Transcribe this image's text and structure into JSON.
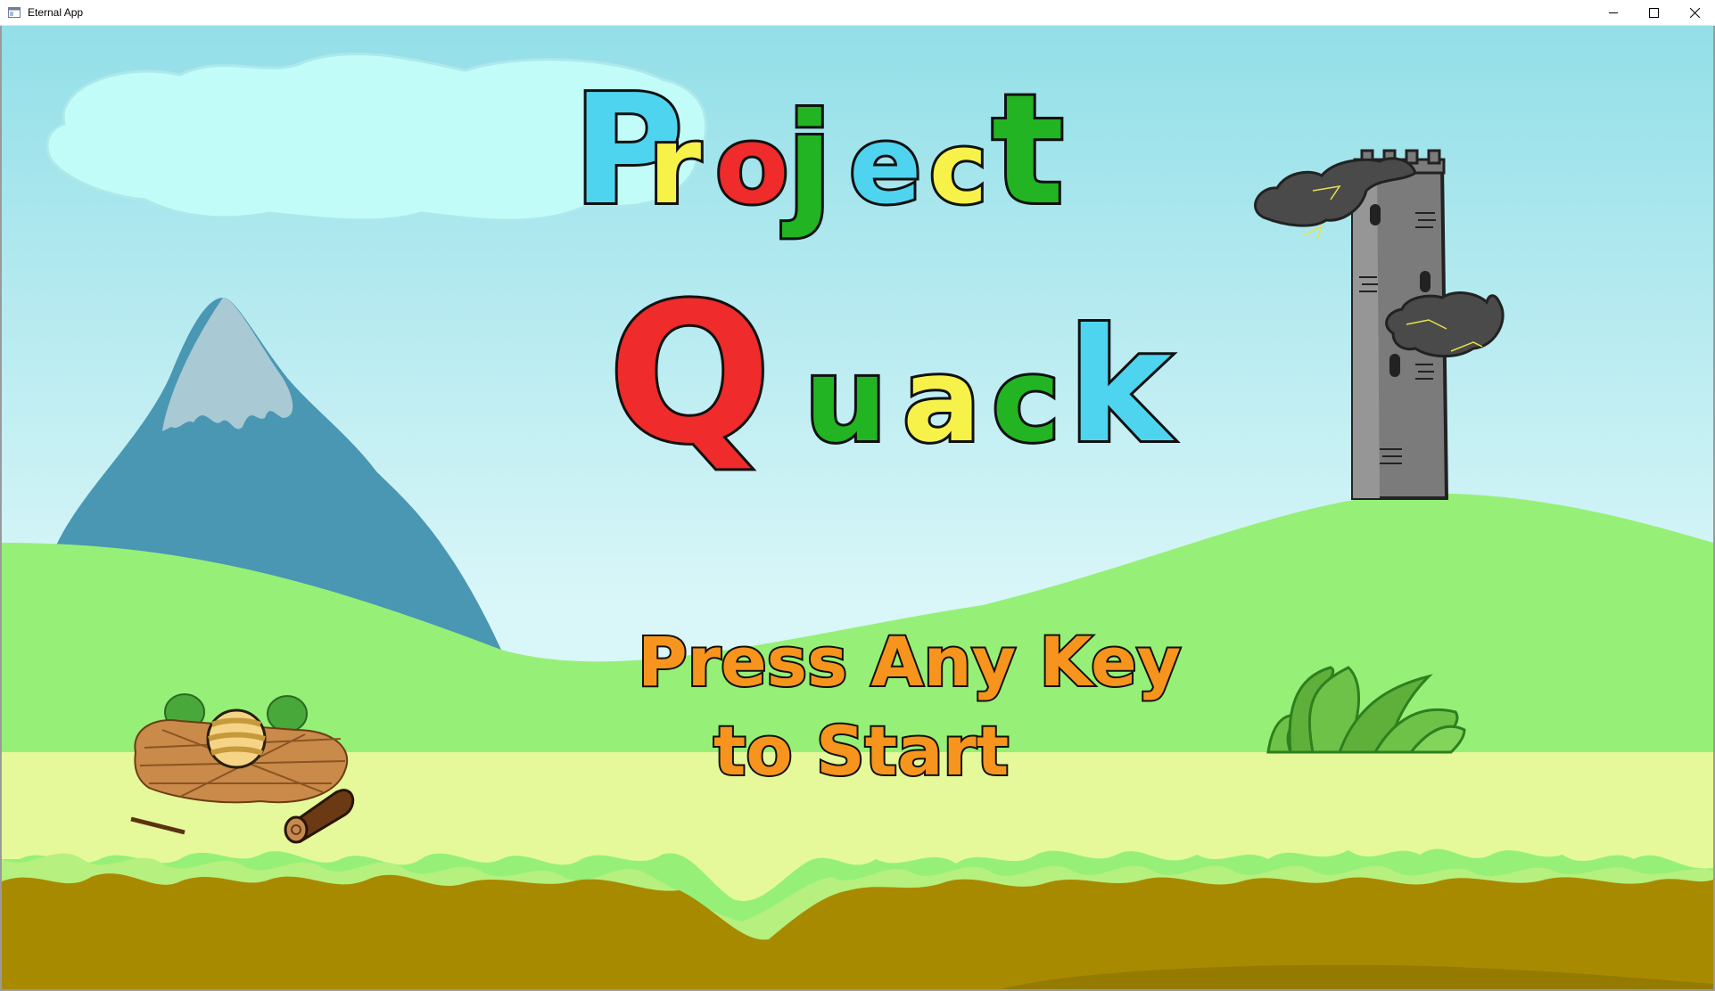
{
  "window": {
    "title": "Eternal App",
    "icon": "app-window-icon",
    "controls": [
      "minimize-icon",
      "maximize-icon",
      "close-icon"
    ]
  },
  "game": {
    "title_line1": [
      "P",
      "r",
      "o",
      "j",
      "e",
      "c",
      "t"
    ],
    "title_line1_colors": [
      "#4fd4f0",
      "#f7f24a",
      "#ef2b2b",
      "#22b422",
      "#4fd4f0",
      "#f7f24a",
      "#22b422"
    ],
    "title_line2": [
      "Q",
      "u",
      "a",
      "c",
      "k"
    ],
    "title_line2_colors": [
      "#ef2b2b",
      "#22b422",
      "#f7f24a",
      "#22b422",
      "#4fd4f0"
    ],
    "prompt_line1": "Press Any Key",
    "prompt_line2": "to Start",
    "prompt_color": "#f7941d",
    "scene_elements": [
      "cloud",
      "mountain",
      "tower",
      "storm-cloud",
      "nest",
      "striped-egg",
      "log",
      "grass-tuft"
    ],
    "colors": {
      "sky_top": "#93dfe8",
      "sky_bottom": "#d9f6f8",
      "hill": "#96f077",
      "meadow": "#e5f99a",
      "soil": "#a88a00"
    }
  }
}
